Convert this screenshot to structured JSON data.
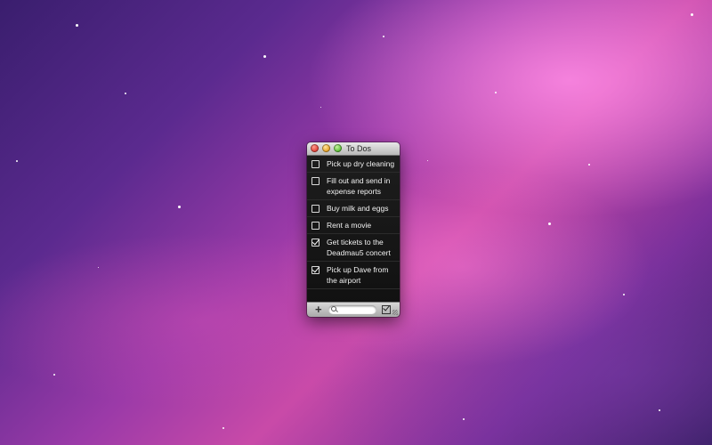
{
  "window": {
    "title": "To Dos"
  },
  "todos": [
    {
      "label": "Pick up dry cleaning",
      "checked": false
    },
    {
      "label": "Fill out and send in expense reports",
      "checked": false
    },
    {
      "label": "Buy milk and eggs",
      "checked": false
    },
    {
      "label": "Rent a movie",
      "checked": false
    },
    {
      "label": "Get tickets to the Deadmau5 concert",
      "checked": true
    },
    {
      "label": "Pick up Dave from the airport",
      "checked": true
    }
  ],
  "toolbar": {
    "search_placeholder": ""
  },
  "icons": {
    "add": "plus-icon",
    "search": "search-icon",
    "clear_completed": "checkbox-check-icon",
    "resize": "resize-grip-icon"
  },
  "colors": {
    "close": "#e0443a",
    "minimize": "#e7a52a",
    "zoom": "#5fbf3a"
  }
}
